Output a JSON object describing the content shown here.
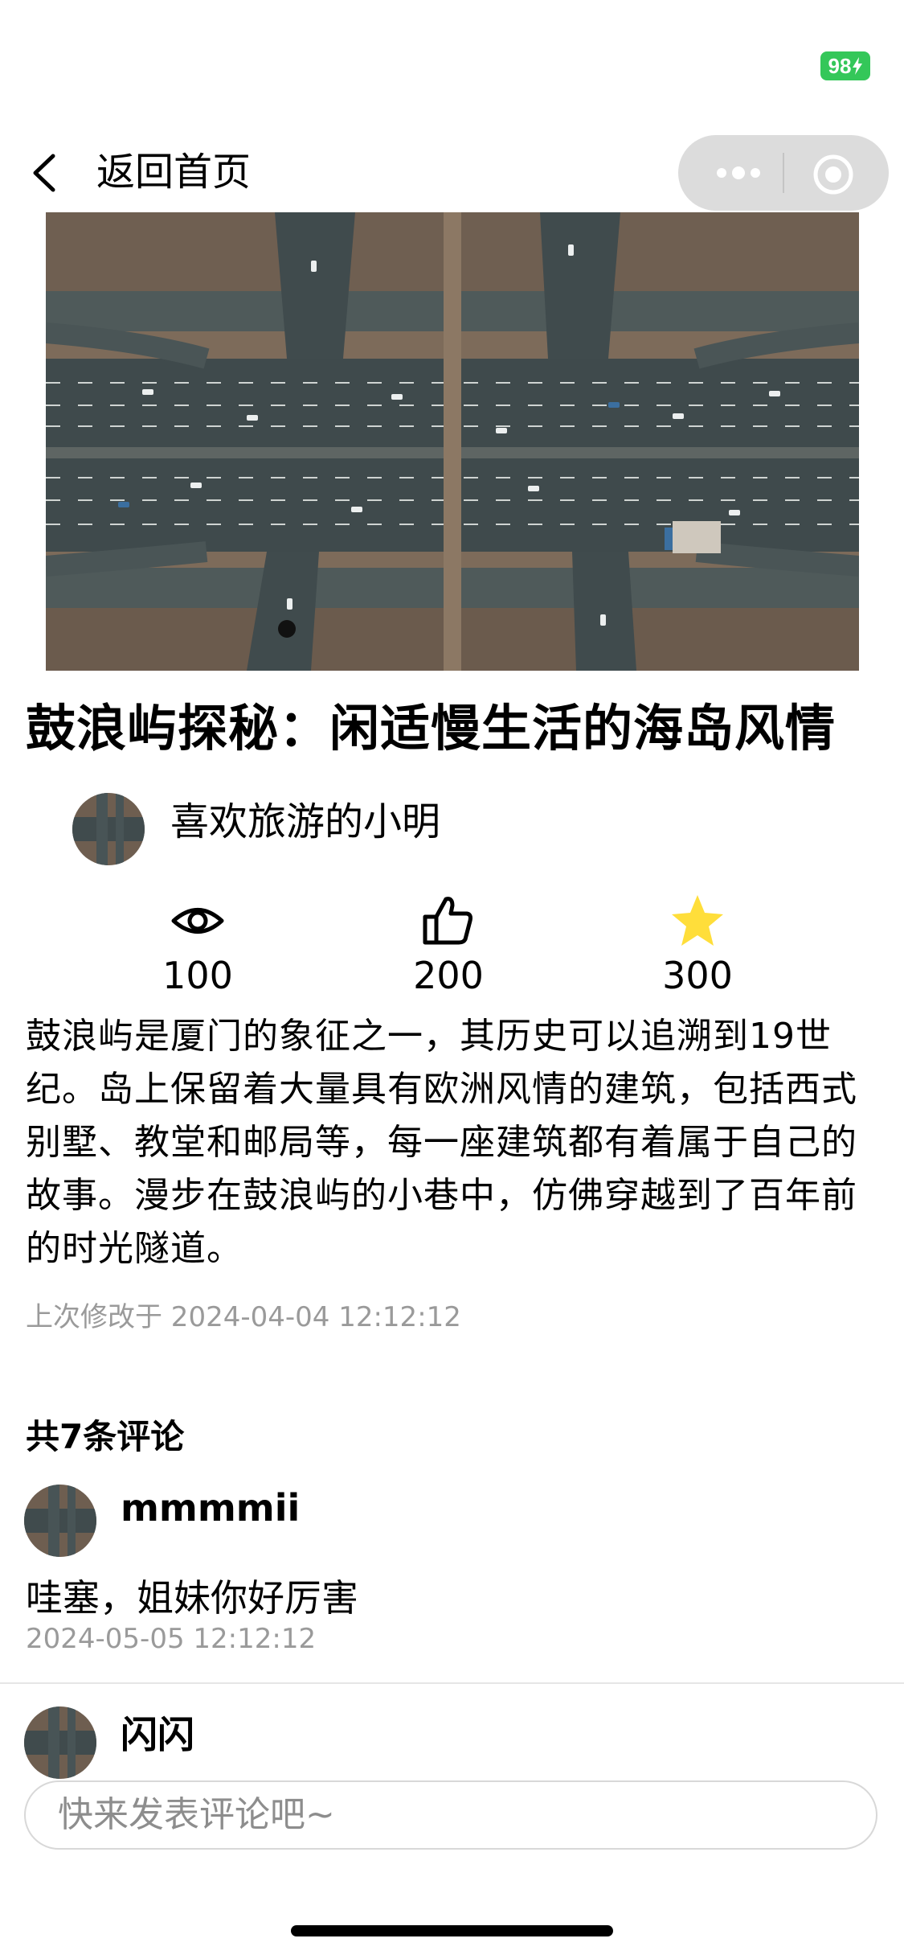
{
  "status_bar": {
    "battery": "98"
  },
  "nav": {
    "back_label": "返回首页"
  },
  "hero": {
    "slides_shown": 1
  },
  "article": {
    "title": "鼓浪屿探秘：闲适慢生活的海岛风情",
    "author": "喜欢旅游的小明",
    "stats": {
      "views": "100",
      "likes": "200",
      "favorites": "300"
    },
    "body": "鼓浪屿是厦门的象征之一，其历史可以追溯到19世纪。岛上保留着大量具有欧洲风情的建筑，包括西式别墅、教堂和邮局等，每一座建筑都有着属于自己的故事。漫步在鼓浪屿的小巷中，仿佛穿越到了百年前的时光隧道。",
    "modified": "上次修改于 2024-04-04 12:12:12"
  },
  "comments": {
    "count_label": "共7条评论",
    "items": [
      {
        "user": "mmmmii",
        "text": "哇塞，姐妹你好厉害",
        "time": "2024-05-05 12:12:12"
      },
      {
        "user": "闪闪"
      }
    ]
  },
  "input": {
    "placeholder": "快来发表评论吧~"
  },
  "colors": {
    "battery": "#34c759",
    "star": "#ffde3a",
    "capsule": "#dcdcdc",
    "muted_text": "#9a9a9a"
  },
  "icons": [
    "back-icon",
    "more-icon",
    "close-mini-program-icon",
    "eye-icon",
    "thumbs-up-icon",
    "star-icon"
  ]
}
